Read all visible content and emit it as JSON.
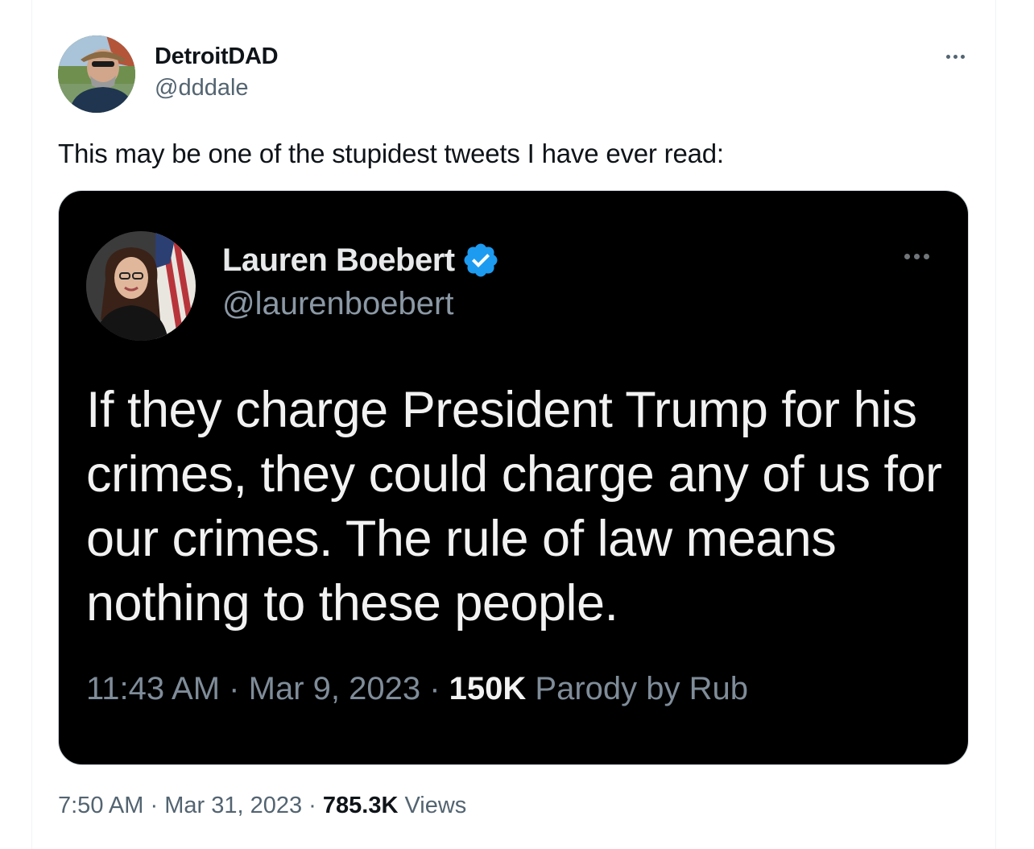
{
  "author": {
    "name": "DetroitDAD",
    "handle": "@dddale"
  },
  "tweet": {
    "text": "This may be one of the stupidest tweets I have ever read:",
    "time": "7:50 AM",
    "date": "Mar 31, 2023",
    "views_count": "785.3K",
    "views_label": "Views",
    "separator": "·"
  },
  "embedded_screenshot": {
    "name": "Lauren Boebert",
    "handle": "@laurenboebert",
    "text": "If they charge President Trump for his crimes, they could charge any of us for our crimes. The rule of law means nothing to these people.",
    "time": "11:43 AM",
    "date": "Mar 9, 2023",
    "views_count": "150K",
    "views_label": "Parody by Rub",
    "separator": "·"
  },
  "icons": {
    "more": "more-horizontal-icon",
    "verified": "verified-badge-icon"
  },
  "colors": {
    "verified_blue": "#1d9bf0",
    "secondary_text": "#536471",
    "media_background": "#000000"
  }
}
